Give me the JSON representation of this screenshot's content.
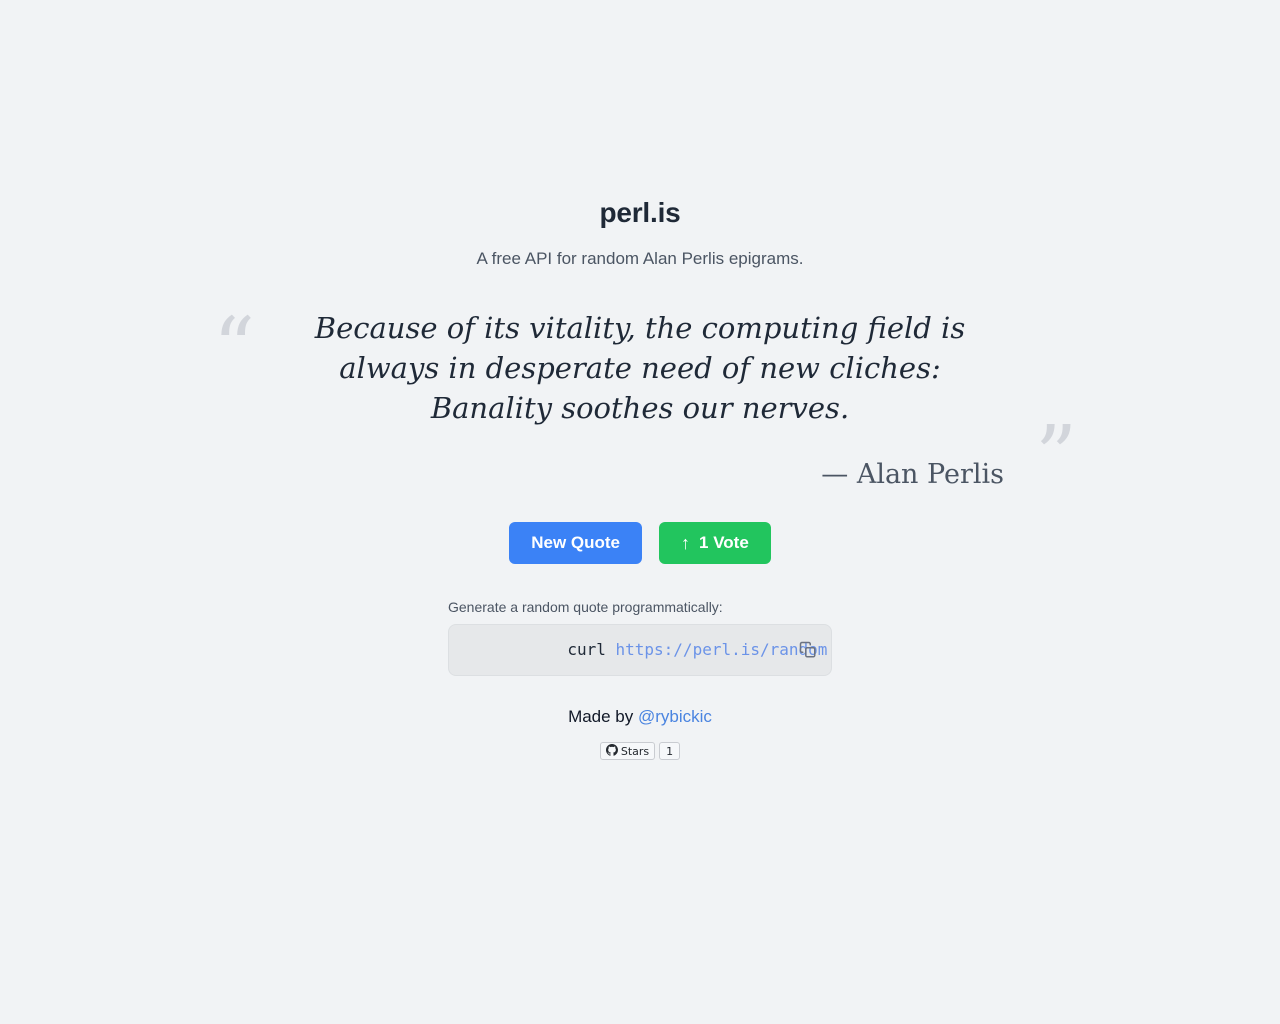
{
  "header": {
    "title": "perl.is",
    "subtitle": "A free API for random Alan Perlis epigrams."
  },
  "quote": {
    "open_mark": "“",
    "close_mark": "”",
    "text": "Because of its vitality, the computing field is always in desperate need of new cliches: Banality soothes our nerves.",
    "attribution": "— Alan Perlis"
  },
  "actions": {
    "new_quote_label": "New Quote",
    "vote_arrow": "↑",
    "vote_label": "1 Vote",
    "new_quote_color": "#3b82f6",
    "vote_color": "#22c55e"
  },
  "api": {
    "label": "Generate a random quote programmatically:",
    "command": "curl ",
    "url": "https://perl.is/random",
    "copy_icon": "copy-icon"
  },
  "footer": {
    "made_by_text": "Made by ",
    "author_handle": "@rybickic",
    "github_badge": {
      "icon": "github-icon",
      "label": "Stars",
      "count": "1"
    }
  }
}
